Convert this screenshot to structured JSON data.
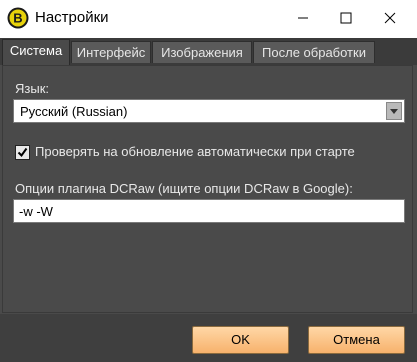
{
  "window": {
    "title": "Настройки"
  },
  "tabs": [
    {
      "label": "Система",
      "active": true
    },
    {
      "label": "Интерфейс",
      "active": false
    },
    {
      "label": "Изображения",
      "active": false
    },
    {
      "label": "После обработки",
      "active": false
    }
  ],
  "system": {
    "language_label": "Язык:",
    "language_value": "Русский (Russian)",
    "update_check_label": "Проверять на обновление автоматически при старте",
    "update_check_checked": true,
    "dcraw_label": "Опции плагина DCRaw (ищите опции DCRaw в Google):",
    "dcraw_value": "-w -W"
  },
  "buttons": {
    "ok": "OK",
    "cancel": "Отмена"
  },
  "icons": {
    "app": "app-logo-icon",
    "minimize": "minimize-icon",
    "maximize": "maximize-icon",
    "close": "close-icon",
    "dropdown": "chevron-down-icon",
    "check": "checkmark-icon"
  },
  "colors": {
    "dialog_bg": "#4a4a4a",
    "button_accent": "#f7b26c",
    "app_icon_yellow": "#e7d20b"
  }
}
